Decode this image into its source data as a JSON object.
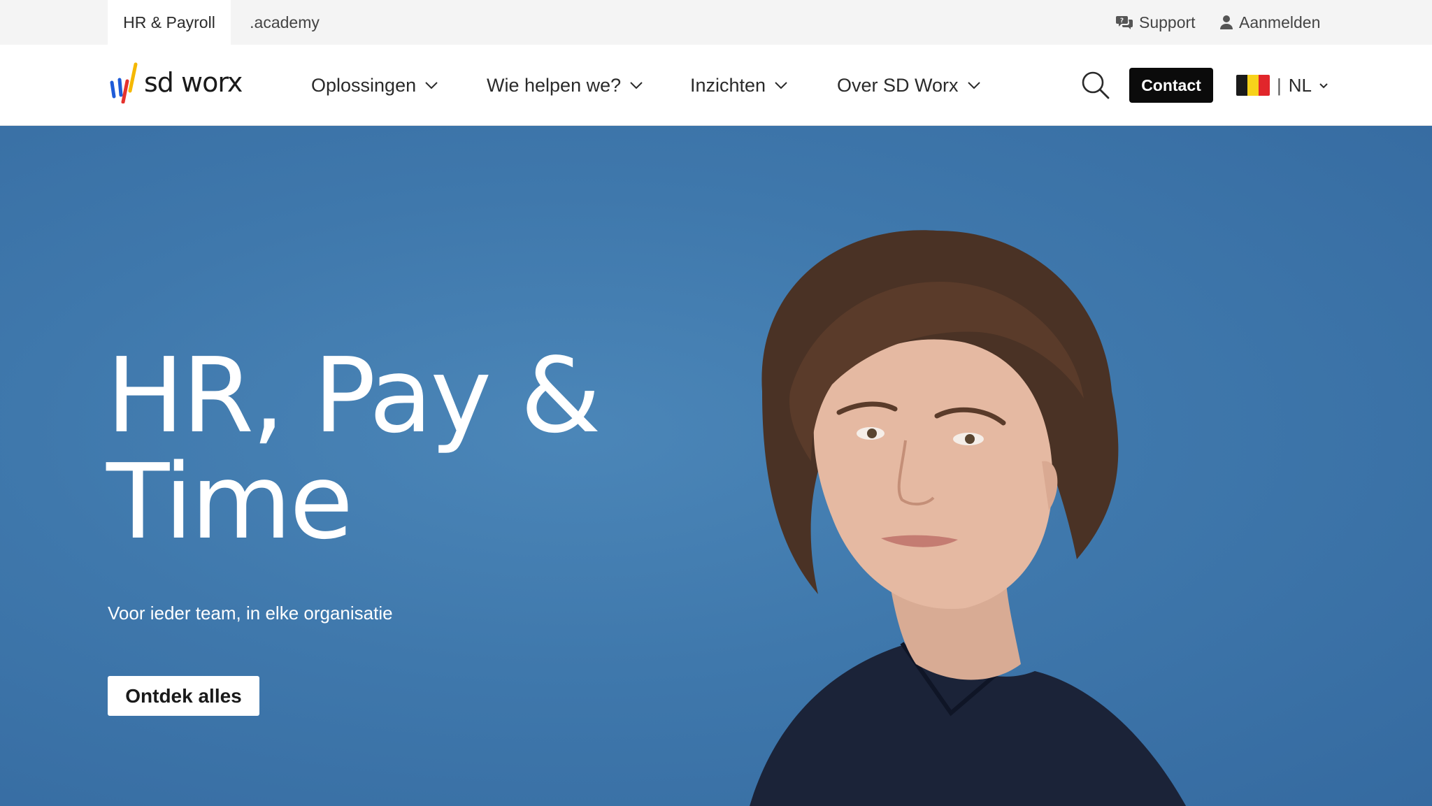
{
  "topbar": {
    "tabs": [
      {
        "label": "HR & Payroll",
        "active": true
      },
      {
        "label": ".academy",
        "active": false
      }
    ],
    "support_label": "Support",
    "login_label": "Aanmelden"
  },
  "header": {
    "logo_text": "sd worx",
    "nav": [
      {
        "label": "Oplossingen"
      },
      {
        "label": "Wie helpen we?"
      },
      {
        "label": "Inzichten"
      },
      {
        "label": "Over SD Worx"
      }
    ],
    "contact_label": "Contact",
    "language": {
      "separator": "|",
      "code": "NL",
      "flag_colors": [
        "#1a1a1a",
        "#f7d21b",
        "#e1262b"
      ]
    }
  },
  "hero": {
    "title": "HR, Pay & Time",
    "subtitle": "Voor ieder team, in elke organisatie",
    "cta_label": "Ontdek alles"
  },
  "colors": {
    "hero_bg": "#3f78ac",
    "brand_blue": "#1e5bd8",
    "brand_red": "#e5322d",
    "brand_yellow": "#f5b800",
    "contact_bg": "#0b0b0b"
  },
  "icons": [
    "support-icon",
    "user-icon",
    "chevron-down-icon",
    "search-icon",
    "language-chevron-icon"
  ]
}
